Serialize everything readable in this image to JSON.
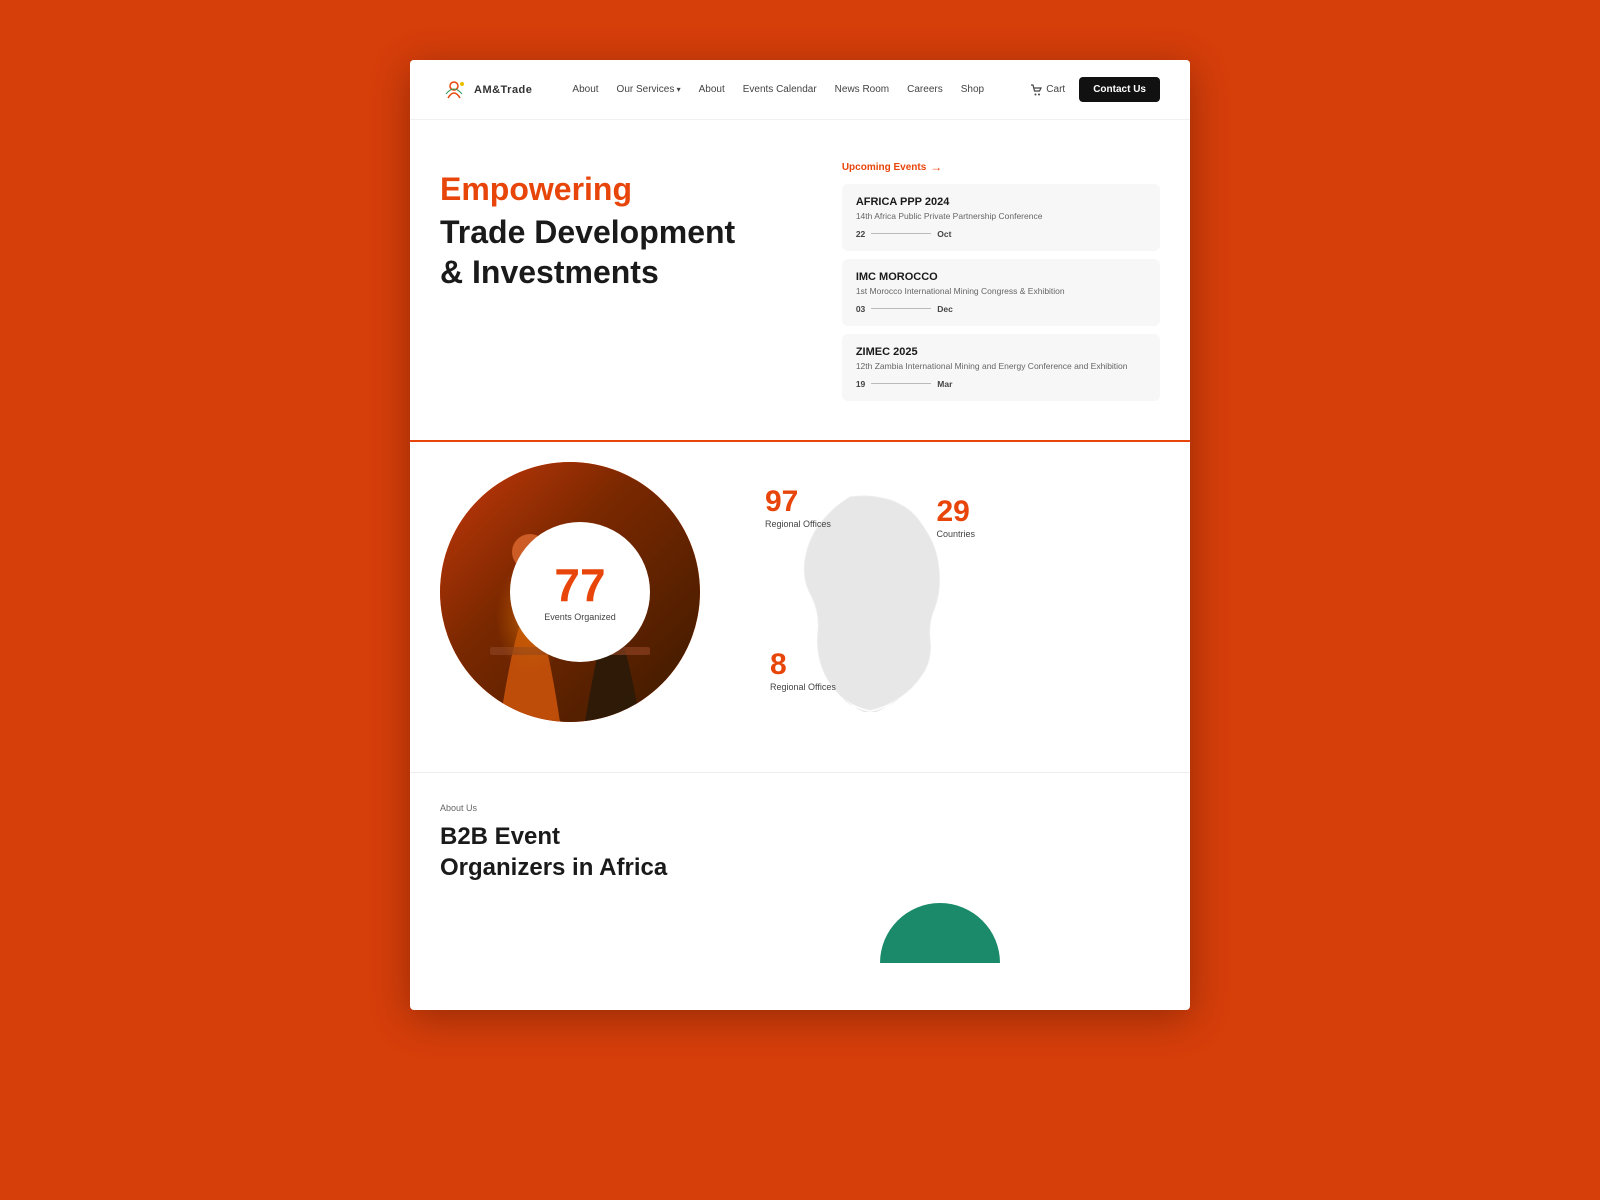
{
  "brand": {
    "logo_text": "AM&Trade",
    "logo_alt": "AMTrade logo"
  },
  "nav": {
    "links": [
      {
        "label": "About",
        "has_arrow": false
      },
      {
        "label": "Our Services",
        "has_arrow": true
      },
      {
        "label": "About",
        "has_arrow": false
      },
      {
        "label": "Events Calendar",
        "has_arrow": false
      },
      {
        "label": "News Room",
        "has_arrow": false
      },
      {
        "label": "Careers",
        "has_arrow": false
      },
      {
        "label": "Shop",
        "has_arrow": false
      }
    ],
    "cart_label": "Cart",
    "contact_label": "Contact Us"
  },
  "hero": {
    "title_orange": "Empowering",
    "title_line2": "Trade Development",
    "title_line3": "& Investments"
  },
  "events": {
    "section_label": "Upcoming Events",
    "arrow": "→",
    "items": [
      {
        "name": "AFRICA PPP 2024",
        "desc": "14th Africa Public Private Partnership Conference",
        "date_start": "22",
        "date_end": "Oct"
      },
      {
        "name": "IMC MOROCCO",
        "desc": "1st Morocco International Mining Congress & Exhibition",
        "date_start": "03",
        "date_end": "Dec"
      },
      {
        "name": "ZIMEC 2025",
        "desc": "12th Zambia International Mining and Energy Conference and Exhibition",
        "date_start": "19",
        "date_end": "Mar"
      }
    ]
  },
  "stats": {
    "circle_number": "77",
    "circle_label": "Events Organized",
    "stat1_number": "97",
    "stat1_label": "Regional Offices",
    "stat2_number": "29",
    "stat2_label": "Countries",
    "stat3_number": "8",
    "stat3_label": "Regional Offices"
  },
  "about": {
    "section_label": "About Us",
    "title_line1": "B2B Event",
    "title_line2": "Organizers in Africa"
  }
}
